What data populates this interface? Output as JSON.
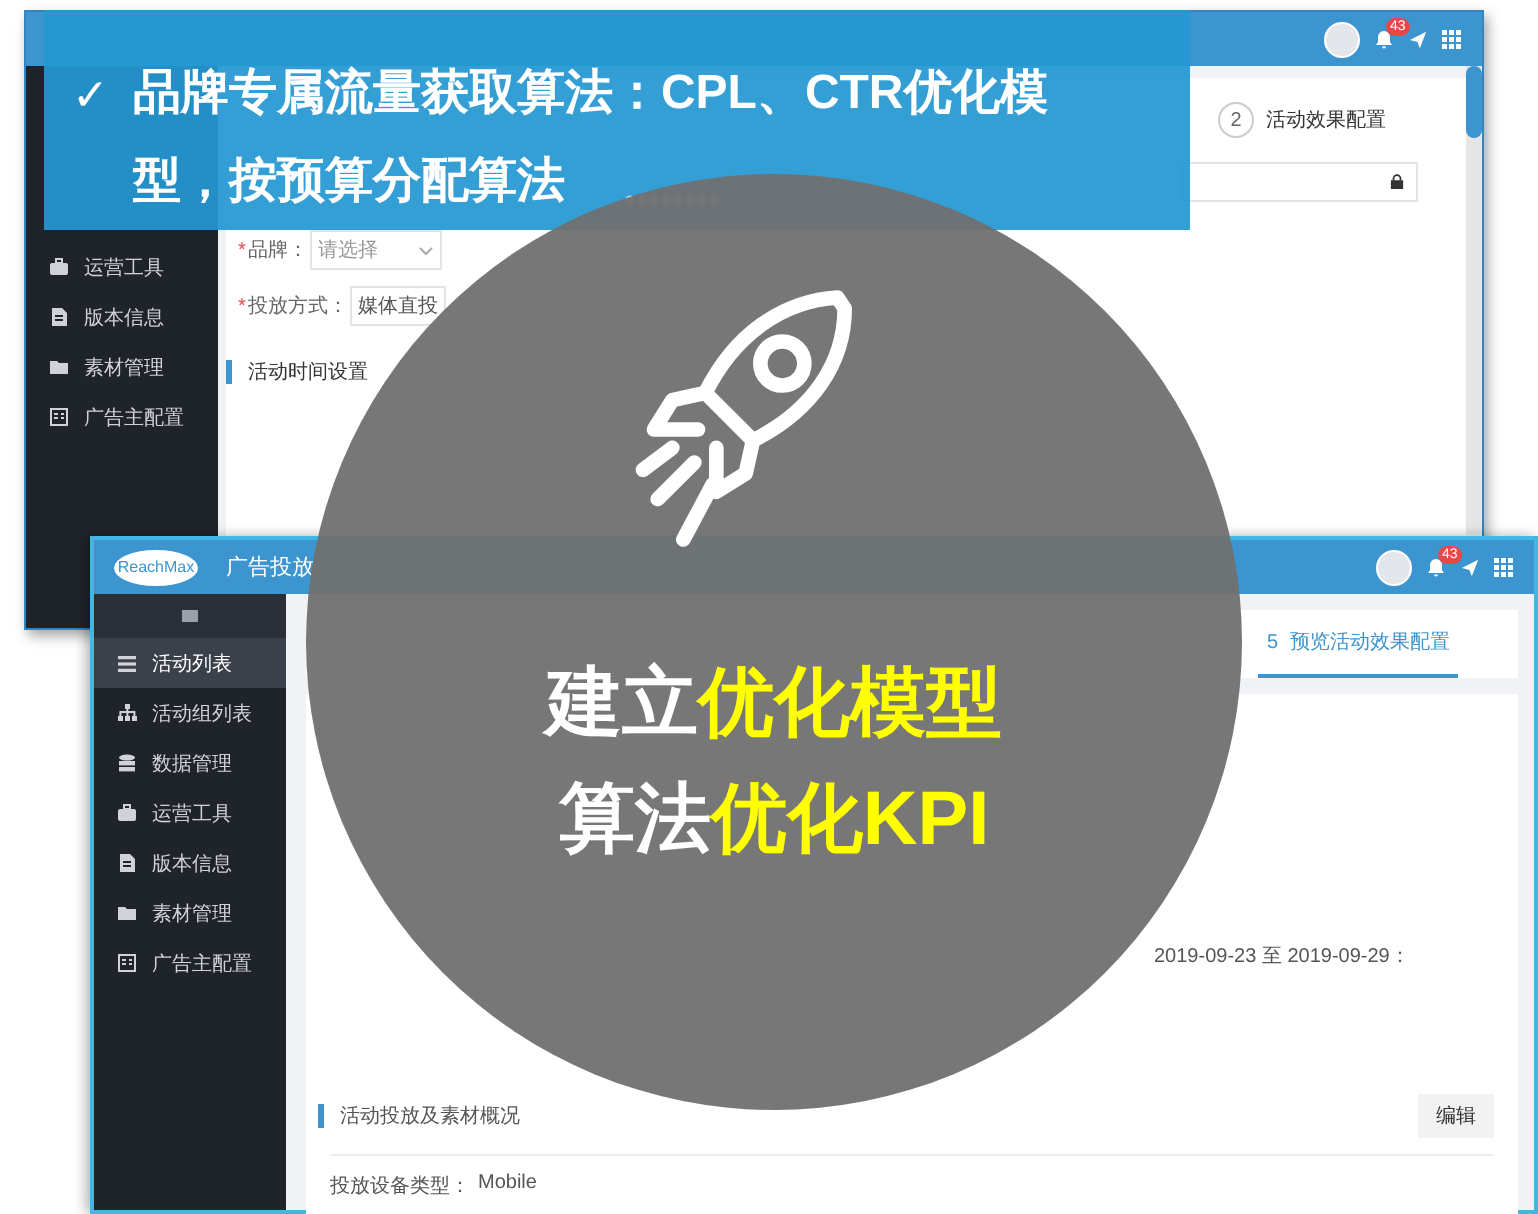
{
  "back_window": {
    "notification_count": "43",
    "sidebar": {
      "items": [
        {
          "label": "运营工具"
        },
        {
          "label": "版本信息"
        },
        {
          "label": "素材管理"
        },
        {
          "label": "广告主配置"
        }
      ]
    },
    "step": {
      "number": "2",
      "label": "活动效果配置"
    },
    "form": {
      "fields": [
        {
          "required_mark": "*",
          "label": "品牌：",
          "placeholder": "请选择"
        },
        {
          "required_mark": "*",
          "label": "投放方式：",
          "value": "媒体直投"
        }
      ],
      "section": "活动时间设置"
    }
  },
  "front_window": {
    "logo": "ReachMax",
    "title": "广告投放",
    "notification_count": "43",
    "sidebar": {
      "items": [
        {
          "label": "活动列表",
          "selected": true
        },
        {
          "label": "活动组列表",
          "selected": false
        },
        {
          "label": "数据管理",
          "selected": false
        },
        {
          "label": "运营工具",
          "selected": false
        },
        {
          "label": "版本信息",
          "selected": false
        },
        {
          "label": "素材管理",
          "selected": false
        },
        {
          "label": "广告主配置",
          "selected": false
        }
      ]
    },
    "steps": [
      {
        "number": "5",
        "label": "预览活动效果配置",
        "selected": true
      }
    ],
    "info": {
      "budget": [
        "2019-09-23 至 2019-09-29："
      ]
    },
    "materials": {
      "title": "活动投放及素材概况",
      "edit_button": "编辑",
      "device_label": "投放设备类型：",
      "device_value": "Mobile"
    }
  },
  "banner": {
    "check": "✓",
    "text": "品牌专属流量获取算法：CPL、CTR优化模型，按预算分配算法"
  },
  "circle": {
    "lines": [
      [
        {
          "text": "建立",
          "highlight": false
        },
        {
          "text": "优化模型",
          "highlight": true
        }
      ],
      [
        {
          "text": "算法",
          "highlight": false
        },
        {
          "text": "优化KPI",
          "highlight": true
        }
      ]
    ]
  }
}
